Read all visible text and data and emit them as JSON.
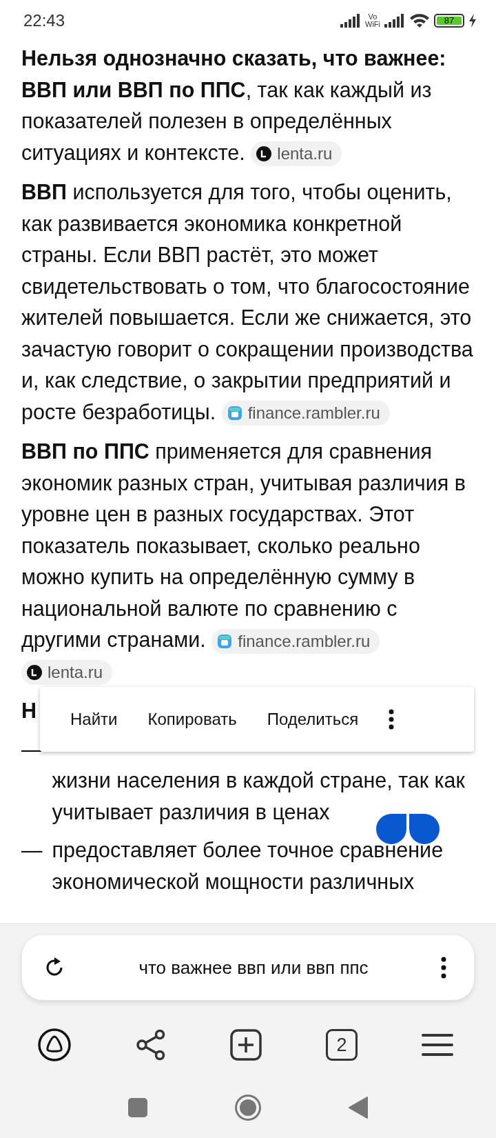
{
  "status_bar": {
    "time": "22:43",
    "volte": "Vo",
    "wifi_calling": "WiFi",
    "battery": "87"
  },
  "paragraphs": [
    {
      "text": "**Нельзя однозначно сказать, что важнее: ВВП или ВВП по ППС**, так как каждый из показателей полезен в определённых ситуациях и контексте.",
      "sources": [
        {
          "kind": "lenta",
          "label": "lenta.ru"
        }
      ]
    },
    {
      "text": "**ВВП** используется для того, чтобы оценить, как развивается экономика конкретной страны. Если ВВП растёт, это может свидетельствовать о том, что благосостояние жителей повышается. Если же снижается, это зачастую говорит о сокращении производства и, как следствие, о закрытии предприятий и росте безработицы.",
      "sources": [
        {
          "kind": "rambler",
          "label": "finance.rambler.ru"
        }
      ]
    },
    {
      "text": "**ВВП по ППС** применяется для сравнения экономик разных стран, учитывая различия в уровне цен в разных государствах. Этот показатель показывает, сколько реально можно купить на определённую сумму в национальной валюте по сравнению с другими странами.",
      "sources": [
        {
          "kind": "rambler",
          "label": "finance.rambler.ru"
        },
        {
          "kind": "lenta",
          "label": "lenta.ru"
        }
      ]
    }
  ],
  "heading": "Н",
  "list_items": [
    "жизни населения в каждой стране, так как учитывает различия в ценах",
    "предоставляет более точное сравнение экономической мощности различных"
  ],
  "list_marker": "—",
  "context_menu": {
    "items": [
      "Найти",
      "Копировать",
      "Поделиться"
    ]
  },
  "address_bar": {
    "query": "что важнее ввп или ввп ппс"
  },
  "toolbar": {
    "tab_count": "2"
  }
}
